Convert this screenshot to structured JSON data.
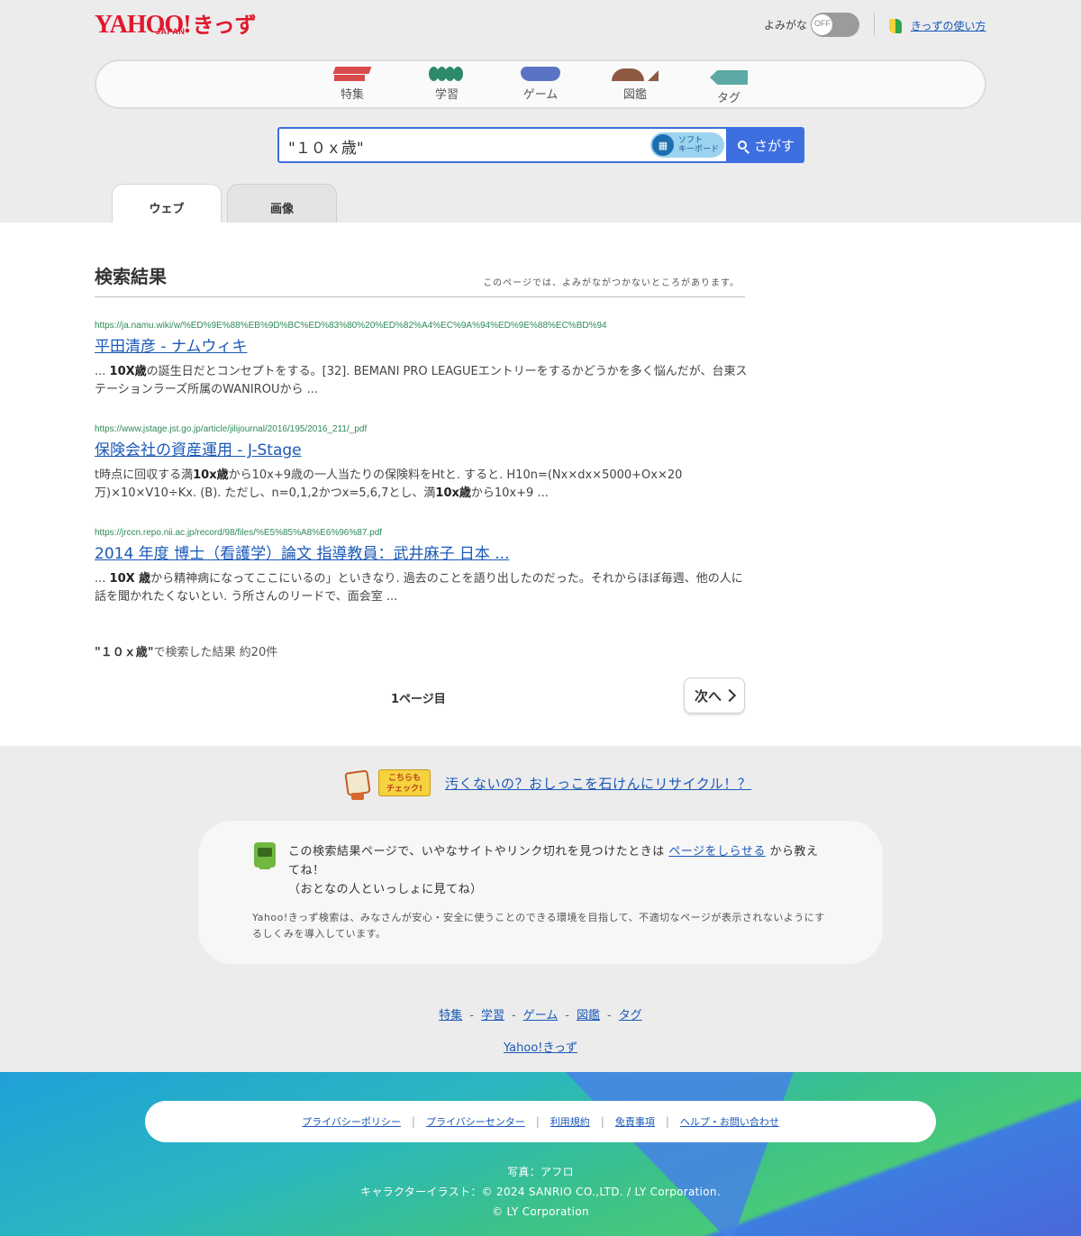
{
  "header": {
    "logo": {
      "yahoo": "YAHOO!",
      "japan": "JAPAN",
      "kids": "きっず"
    },
    "yomigana": {
      "label": "よみがな",
      "state": "OFF"
    },
    "howto_link": "きっずの使い方"
  },
  "nav": {
    "items": [
      {
        "label": "特集",
        "color": "#d94b4b"
      },
      {
        "label": "学習",
        "color": "#2c8a6a"
      },
      {
        "label": "ゲーム",
        "color": "#5b73c4"
      },
      {
        "label": "図鑑",
        "color": "#8e5a42"
      },
      {
        "label": "タグ",
        "color": "#5ba8a4"
      }
    ]
  },
  "search": {
    "query": "\"１０ｘ歳\"",
    "soft_keyboard": {
      "line1": "ソフト",
      "line2": "キーボード"
    },
    "button_label": "さがす",
    "accent_color": "#3d6fe0"
  },
  "tabs": [
    {
      "label": "ウェブ",
      "active": true
    },
    {
      "label": "画像",
      "active": false
    }
  ],
  "results": {
    "heading": "検索結果",
    "note": "このページでは、よみがながつかないところがあります。",
    "items": [
      {
        "url": "https://ja.namu.wiki/w/%ED%9E%88%EB%9D%BC%ED%83%80%20%ED%82%A4%EC%9A%94%ED%9E%88%EC%BD%94",
        "title": "平田清彦 - ナムウィキ",
        "snippet_pre": "... ",
        "snippet_bold": "10X歳",
        "snippet_post": "の誕生日だとコンセプトをする。[32]. BEMANI PRO LEAGUEエントリーをするかどうかを多く悩んだが、台東ステーションラーズ所属のWANIROUから ..."
      },
      {
        "url": "https://www.jstage.jst.go.jp/article/jilijournal/2016/195/2016_211/_pdf",
        "title": "保険会社の資産運用 - J-Stage",
        "snippet_pre": "t時点に回収する満",
        "snippet_bold": "10x歳",
        "snippet_mid": "から10x+9歳の一人当たりの保険料をHtと. すると. H10n=(Nx×dx×5000+Ox×20万)×10×V10÷Kx. (B). ただし、n=0,1,2かつx=5,6,7とし、満",
        "snippet_bold2": "10x歳",
        "snippet_post": "から10x+9 ..."
      },
      {
        "url": "https://jrccn.repo.nii.ac.jp/record/98/files/%E5%85%A8%E6%96%87.pdf",
        "title": "2014 年度 博士（看護学）論文 指導教員：武井麻子 日本 ...",
        "snippet_pre": "... ",
        "snippet_bold": "10X 歳",
        "snippet_post": "から精神病になってここにいるの」といきなり. 過去のことを語り出したのだった。それからほぼ毎週、他の人に話を聞かれたくないとい. う所さんのリードで、面会室 ..."
      }
    ],
    "summary_query": "\"１０ｘ歳\"",
    "summary_text": "で検索した結果 約20件",
    "page_label": "1ページ目",
    "next_label": "次へ"
  },
  "footer": {
    "check_badge": {
      "line1": "こちらも",
      "line2": "チェック!"
    },
    "check_link": "汚くないの？おしっこを石けんにリサイクル！？",
    "report": {
      "text_pre": "この検索結果ページで、いやなサイトやリンク切れを見つけたときは",
      "link": "ページをしらせる",
      "text_post": "から教えてね！",
      "line2": "（おとなの人といっしょに見てね）",
      "sub": "Yahoo!きっず検索は、みなさんが安心・安全に使うことのできる環境を目指して、不適切なページが表示されないようにするしくみを導入しています。"
    },
    "nav": [
      "特集",
      "学習",
      "ゲーム",
      "図鑑",
      "タグ"
    ],
    "nav_sep": "-",
    "home_link": "Yahoo!きっず",
    "legal": [
      "プライバシーポリシー",
      "プライバシーセンター",
      "利用規約",
      "免責事項",
      "ヘルプ・お問い合わせ"
    ],
    "legal_sep": "|",
    "credits": {
      "photo": "写真：アフロ",
      "illust": "キャラクターイラスト：© 2024 SANRIO CO.,LTD. / LY Corporation.",
      "copyright": "© LY Corporation"
    }
  }
}
